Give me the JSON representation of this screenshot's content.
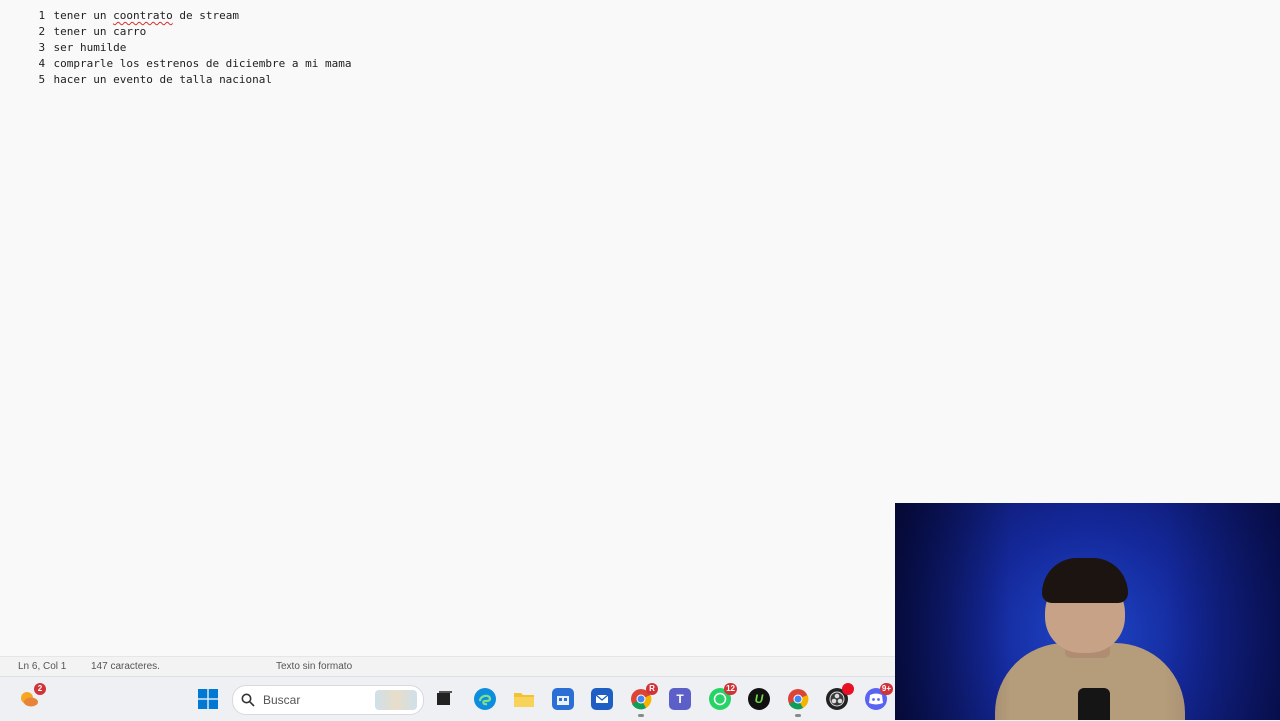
{
  "editor": {
    "lines": [
      {
        "num": "1",
        "text_a": "tener un ",
        "text_spell": "coontrato",
        "text_b": " de stream"
      },
      {
        "num": "2",
        "text": "tener un carro"
      },
      {
        "num": "3",
        "text": "ser humilde"
      },
      {
        "num": "4",
        "text": "comprarle los estrenos de diciembre a mi mama"
      },
      {
        "num": "5",
        "text": "hacer un evento de talla nacional"
      }
    ]
  },
  "statusbar": {
    "position": "Ln 6, Col 1",
    "chars": "147 caracteres.",
    "format": "Texto sin formato"
  },
  "taskbar": {
    "search_placeholder": "Buscar",
    "weather_badge": "2",
    "chrome_badge": "R",
    "whatsapp_badge": "12",
    "discord_badge": "9+",
    "colors": {
      "windows": "#0078d4",
      "edge": "#0c8de0",
      "folder": "#f2c230",
      "store": "#2b6fd6",
      "outlook": "#1f5fc4",
      "teams": "#5b5fc7",
      "whatsapp": "#25d366",
      "discord": "#5865f2"
    }
  }
}
